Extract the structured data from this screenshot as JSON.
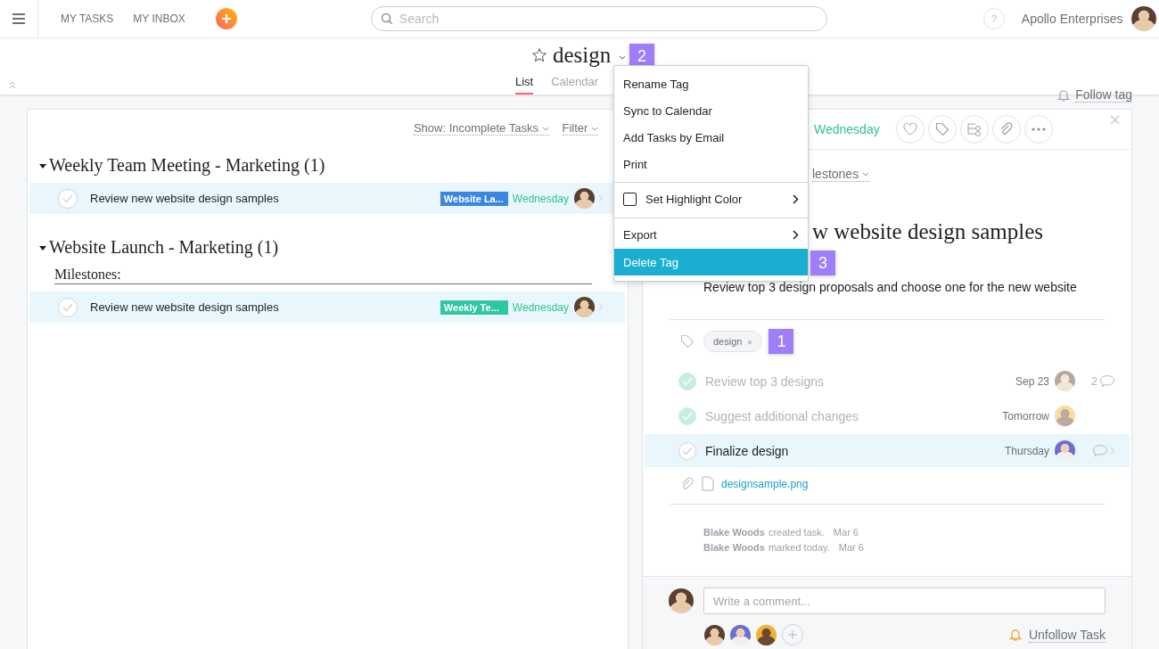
{
  "topbar": {
    "nav": [
      {
        "label": "MY TASKS"
      },
      {
        "label": "MY INBOX"
      }
    ],
    "search": {
      "placeholder": "Search"
    },
    "help": "?",
    "org": "Apollo Enterprises"
  },
  "header": {
    "title": "design",
    "starred": false,
    "callout": "2",
    "tabs": [
      {
        "label": "List",
        "selected": true
      },
      {
        "label": "Calendar",
        "selected": false
      }
    ],
    "follow": "Follow tag"
  },
  "menu": {
    "callout": "3",
    "items": [
      {
        "kind": "item",
        "label": "Rename Tag",
        "selected": false,
        "divider_before": false,
        "submenu": false
      },
      {
        "kind": "item",
        "label": "Sync to Calendar",
        "selected": false,
        "divider_before": false,
        "submenu": false
      },
      {
        "kind": "item",
        "label": "Add Tasks by Email",
        "selected": false,
        "divider_before": false,
        "submenu": false
      },
      {
        "kind": "item",
        "label": "Print",
        "selected": false,
        "divider_before": false,
        "submenu": false
      },
      {
        "kind": "checkbox",
        "label": "Set Highlight Color",
        "checked": false,
        "selected": false,
        "divider_before": true,
        "submenu": true
      },
      {
        "kind": "item",
        "label": "Export",
        "selected": false,
        "divider_before": true,
        "submenu": true
      },
      {
        "kind": "item",
        "label": "Delete Tag",
        "selected": true,
        "divider_before": false,
        "submenu": false
      }
    ]
  },
  "list": {
    "show": "Show: Incomplete Tasks",
    "filter": "Filter",
    "sections": [
      {
        "title": "Weekly Team Meeting - Marketing (1)",
        "expanded": true,
        "tasks": [
          {
            "name": "Review new website design samples",
            "tag": "Website La...",
            "color": "#3b86e0",
            "due": "Wednesday",
            "completed": false
          }
        ]
      },
      {
        "title": "Website Launch - Marketing (1)",
        "expanded": true,
        "subheading": "Milestones:",
        "tasks": [
          {
            "name": "Review new website design samples",
            "tag": "Weekly Te...",
            "color": "#2fc7a3",
            "due": "Wednesday",
            "completed": false
          }
        ]
      }
    ]
  },
  "detail": {
    "due": "Wednesday",
    "project": "lestones",
    "title": "w website design samples",
    "description": "Review top 3 design proposals and choose one for the new website",
    "tags": [
      {
        "label": "design"
      }
    ],
    "tag_callout": "1",
    "subtasks": [
      {
        "name": "Review top 3 designs",
        "due": "Sep 23",
        "completed": true,
        "selected": false,
        "comments": "2"
      },
      {
        "name": "Suggest additional changes",
        "due": "Tomorrow",
        "completed": true,
        "selected": false
      },
      {
        "name": "Finalize design",
        "due": "Thursday",
        "completed": false,
        "selected": true
      }
    ],
    "attachment": "designsample.png",
    "activity": [
      {
        "actor": "Blake Woods",
        "action": "created task.",
        "date": "Mar 6"
      },
      {
        "actor": "Blake Woods",
        "action": "marked today.",
        "date": "Mar 6"
      }
    ],
    "comment": {
      "placeholder": "Write a comment..."
    },
    "unfollow": "Unfollow Task"
  }
}
